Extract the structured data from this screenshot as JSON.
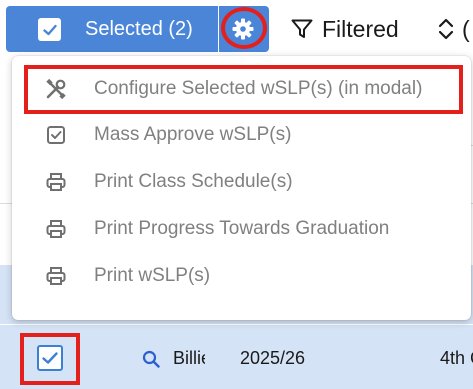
{
  "toolbar": {
    "selected_label": "Selected (2)",
    "filtered_label": "Filtered",
    "cut_text": "("
  },
  "menu": {
    "items": [
      {
        "label": "Configure Selected wSLP(s) (in modal)",
        "icon": "tools-icon"
      },
      {
        "label": "Mass Approve wSLP(s)",
        "icon": "checkbox-icon"
      },
      {
        "label": "Print Class Schedule(s)",
        "icon": "printer-icon"
      },
      {
        "label": "Print Progress Towards Graduation",
        "icon": "printer-icon"
      },
      {
        "label": "Print wSLP(s)",
        "icon": "printer-icon"
      }
    ]
  },
  "row": {
    "name": "Billie",
    "year": "2025/26",
    "grade": "4th C"
  },
  "colors": {
    "accent_blue": "#4a85d8",
    "highlight_red": "#e3201b",
    "row_selected": "#d5e3f6",
    "menu_text": "#808080"
  }
}
